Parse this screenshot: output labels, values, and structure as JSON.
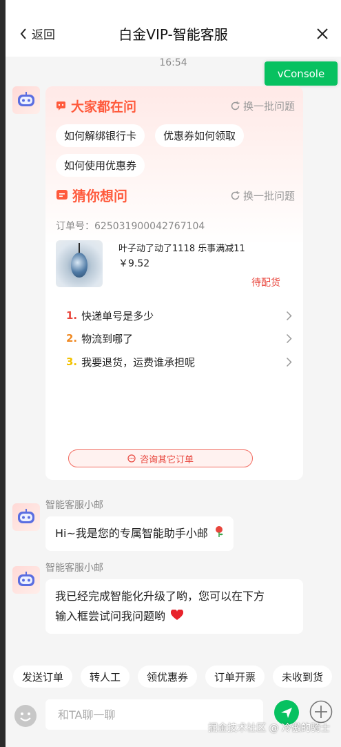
{
  "header": {
    "back_label": "返回",
    "title": "白金VIP-智能客服"
  },
  "timestamp": "16:54",
  "vconsole_label": "vConsole",
  "card": {
    "popular": {
      "title": "大家都在问",
      "refresh_label": "换一批问题",
      "chips": [
        "如何解绑银行卡",
        "优惠券如何领取",
        "如何使用优惠券"
      ]
    },
    "guess": {
      "title": "猜你想问",
      "refresh_label": "换一批问题"
    },
    "order": {
      "number": "订单号：625031900042767104",
      "name": "叶子动了动了1118 乐事满减11",
      "price": "￥9.52",
      "status": "待配货"
    },
    "questions": [
      {
        "num": "1.",
        "text": "快递单号是多少",
        "color": "#e8453c"
      },
      {
        "num": "2.",
        "text": "物流到哪了",
        "color": "#f08a24"
      },
      {
        "num": "3.",
        "text": "我要退货，运费谁承担呢",
        "color": "#f2c200"
      }
    ],
    "other_orders_label": "咨询其它订单"
  },
  "messages": [
    {
      "sender": "智能客服小邮",
      "text": "Hi~我是您的专属智能助手小邮"
    },
    {
      "sender": "智能客服小邮",
      "line1": "我已经完成智能化升级了哟，您可以在下方",
      "line2": "输入框尝试问我问题哟"
    }
  ],
  "quick_actions": [
    "发送订单",
    "转人工",
    "领优惠券",
    "订单开票",
    "未收到货"
  ],
  "input": {
    "placeholder": "和TA聊一聊"
  },
  "watermark": "掘金技术社区 @ 冷傲的骑士",
  "colors": {
    "accent": "#ff5a3c",
    "send": "#07c160",
    "status": "#e8453c"
  }
}
